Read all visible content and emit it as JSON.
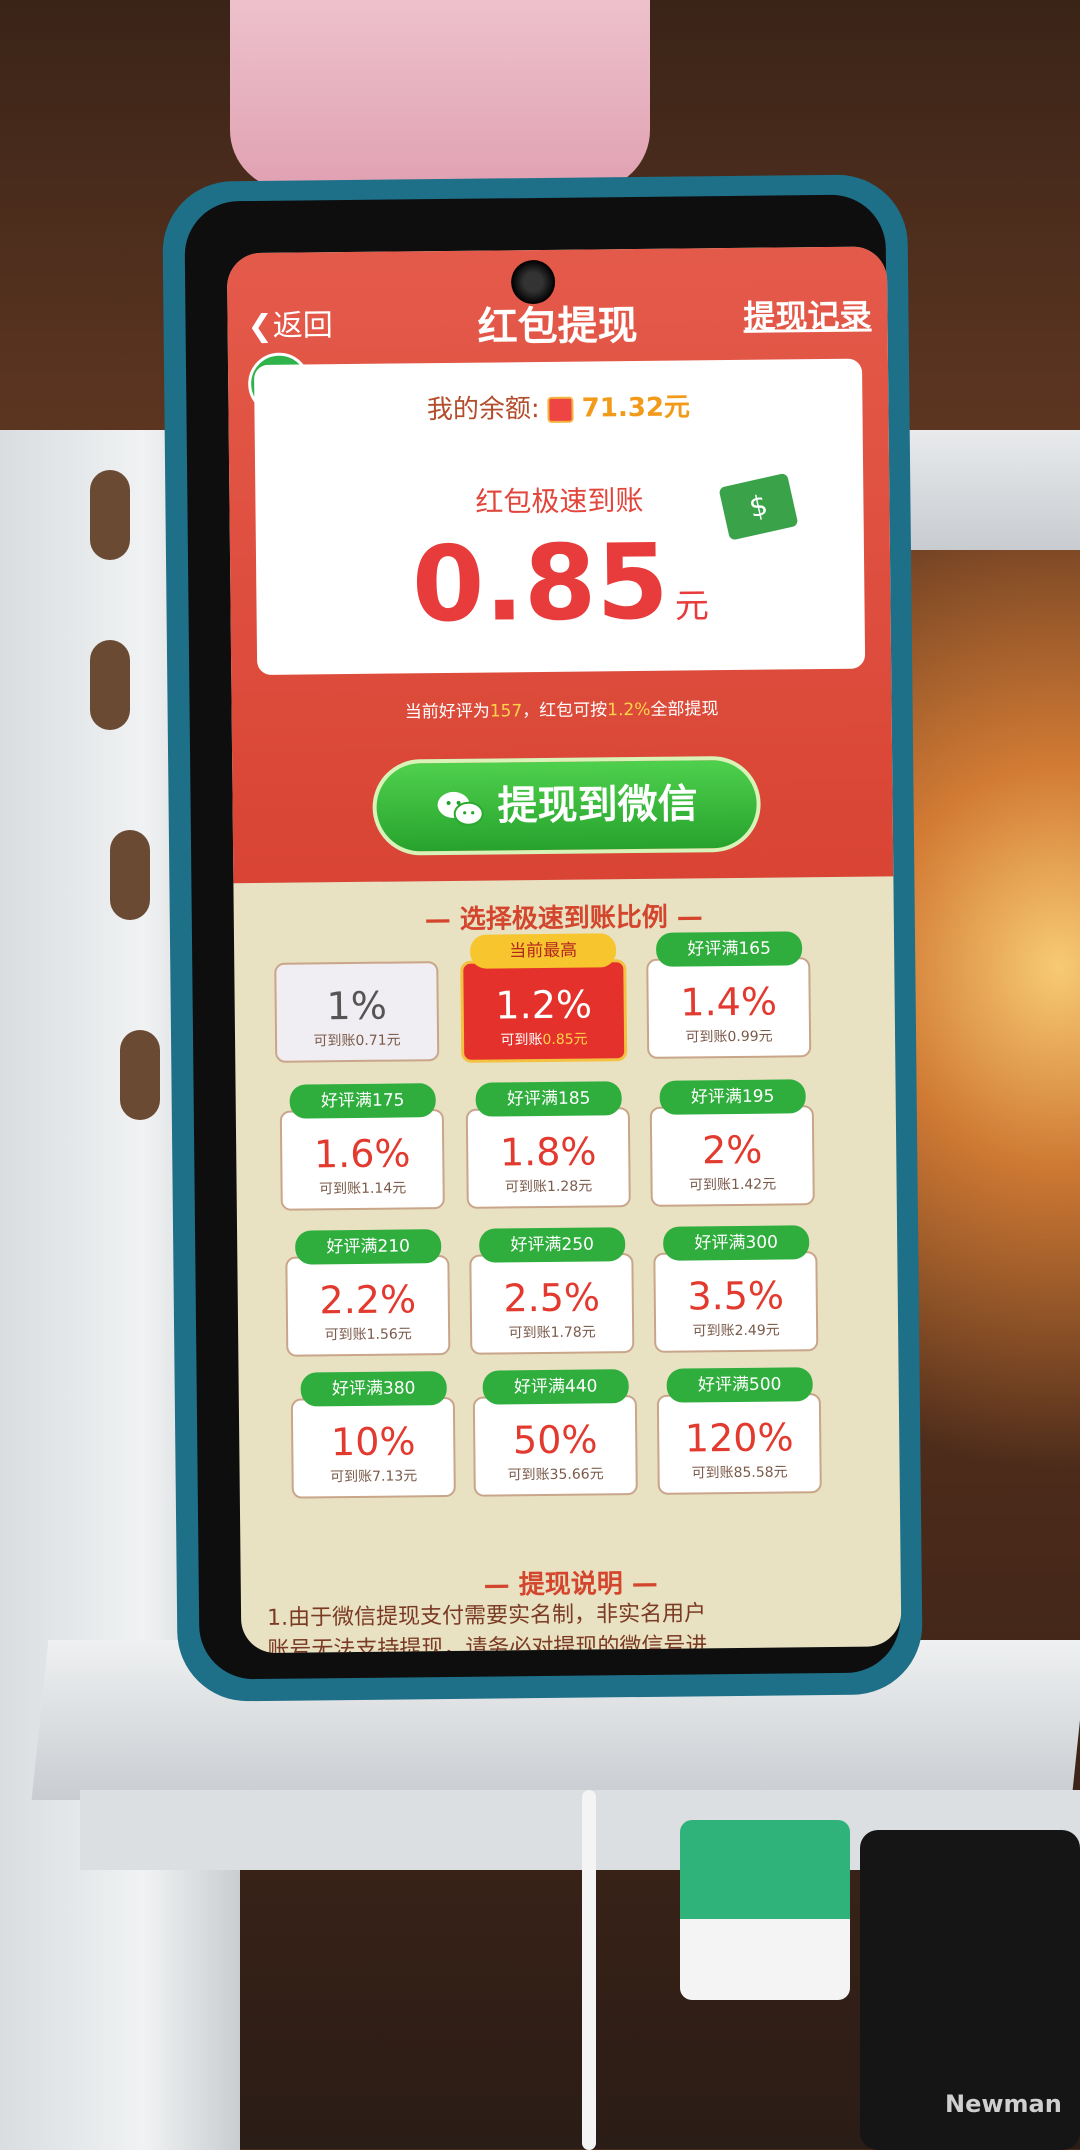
{
  "header": {
    "back_label": "返回",
    "title": "红包提现",
    "record_label": "提现记录"
  },
  "balance": {
    "label": "我的余额:",
    "amount": "71.32元"
  },
  "payout": {
    "label": "红包极速到账",
    "amount": "0.85",
    "unit": "元"
  },
  "rating_info": {
    "prefix": "当前好评为",
    "count": "157",
    "middle": "，红包可按",
    "percent": "1.2%",
    "suffix": "全部提现"
  },
  "withdraw_button": {
    "label": "提现到微信",
    "icon": "wechat-icon"
  },
  "options_title": "— 选择极速到账比例 —",
  "options": [
    {
      "tag": "",
      "percent": "1%",
      "sub": "可到账0.71元"
    },
    {
      "tag": "当前最高",
      "percent": "1.2%",
      "sub_prefix": "可到账",
      "sub_amount": "0.85元"
    },
    {
      "tag": "好评满165",
      "percent": "1.4%",
      "sub": "可到账0.99元"
    },
    {
      "tag": "好评满175",
      "percent": "1.6%",
      "sub": "可到账1.14元"
    },
    {
      "tag": "好评满185",
      "percent": "1.8%",
      "sub": "可到账1.28元"
    },
    {
      "tag": "好评满195",
      "percent": "2%",
      "sub": "可到账1.42元"
    },
    {
      "tag": "好评满210",
      "percent": "2.2%",
      "sub": "可到账1.56元"
    },
    {
      "tag": "好评满250",
      "percent": "2.5%",
      "sub": "可到账1.78元"
    },
    {
      "tag": "好评满300",
      "percent": "3.5%",
      "sub": "可到账2.49元"
    },
    {
      "tag": "好评满380",
      "percent": "10%",
      "sub": "可到账7.13元"
    },
    {
      "tag": "好评满440",
      "percent": "50%",
      "sub": "可到账35.66元"
    },
    {
      "tag": "好评满500",
      "percent": "120%",
      "sub": "可到账85.58元"
    }
  ],
  "notes": {
    "title": "— 提现说明 —",
    "line1": "1.由于微信提现支付需要实名制，非实名用户",
    "line2": "账号无法支持提现，请务必对提现的微信号进"
  },
  "background": {
    "device_label": "Newman"
  },
  "colors": {
    "primary_red": "#e23a2f",
    "green": "#2fae3d",
    "gold": "#f7c62f"
  }
}
